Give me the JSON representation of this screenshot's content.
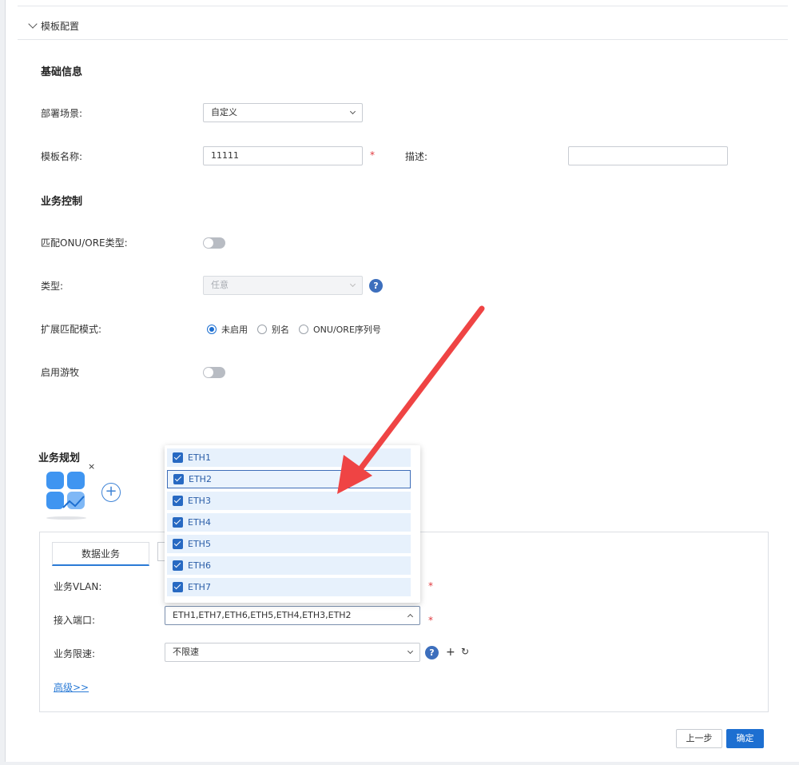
{
  "section": {
    "title": "模板配置"
  },
  "basic": {
    "title": "基础信息",
    "scene_label": "部署场景:",
    "scene_value": "自定义",
    "name_label": "模板名称:",
    "name_value": "11111",
    "required_mark": "*",
    "desc_label": "描述:",
    "desc_value": ""
  },
  "control": {
    "title": "业务控制",
    "match_label": "匹配ONU/ORE类型:",
    "match_enabled": false,
    "type_label": "类型:",
    "type_value": "任意",
    "help_glyph": "?",
    "ext_label": "扩展匹配模式:",
    "ext_options": [
      "未启用",
      "别名",
      "ONU/ORE序列号"
    ],
    "ext_selected": "未启用",
    "roam_label": "启用游牧",
    "roam_enabled": false
  },
  "planning": {
    "title": "业务规划",
    "close_glyph": "×",
    "add_glyph": "+",
    "tab_label": "数据业务",
    "vlan_label": "业务VLAN:",
    "port_label": "接入端口:",
    "port_value": "ETH1,ETH7,ETH6,ETH5,ETH4,ETH3,ETH2",
    "rate_label": "业务限速:",
    "rate_value": "不限速",
    "plus_glyph": "+",
    "refresh_glyph": "↻",
    "advanced_link": "高级>>"
  },
  "dropdown": {
    "options": [
      {
        "label": "ETH1",
        "checked": true
      },
      {
        "label": "ETH2",
        "checked": true
      },
      {
        "label": "ETH3",
        "checked": true
      },
      {
        "label": "ETH4",
        "checked": true
      },
      {
        "label": "ETH5",
        "checked": true
      },
      {
        "label": "ETH6",
        "checked": true
      },
      {
        "label": "ETH7",
        "checked": true
      }
    ],
    "hovered": "ETH2"
  },
  "footer": {
    "prev_label": "上一步",
    "confirm_label": "确定"
  },
  "colors": {
    "primary": "#1d6fd1",
    "required": "#e0393e",
    "arrow": "#ef4444",
    "option_bg": "#e7f1fc"
  }
}
